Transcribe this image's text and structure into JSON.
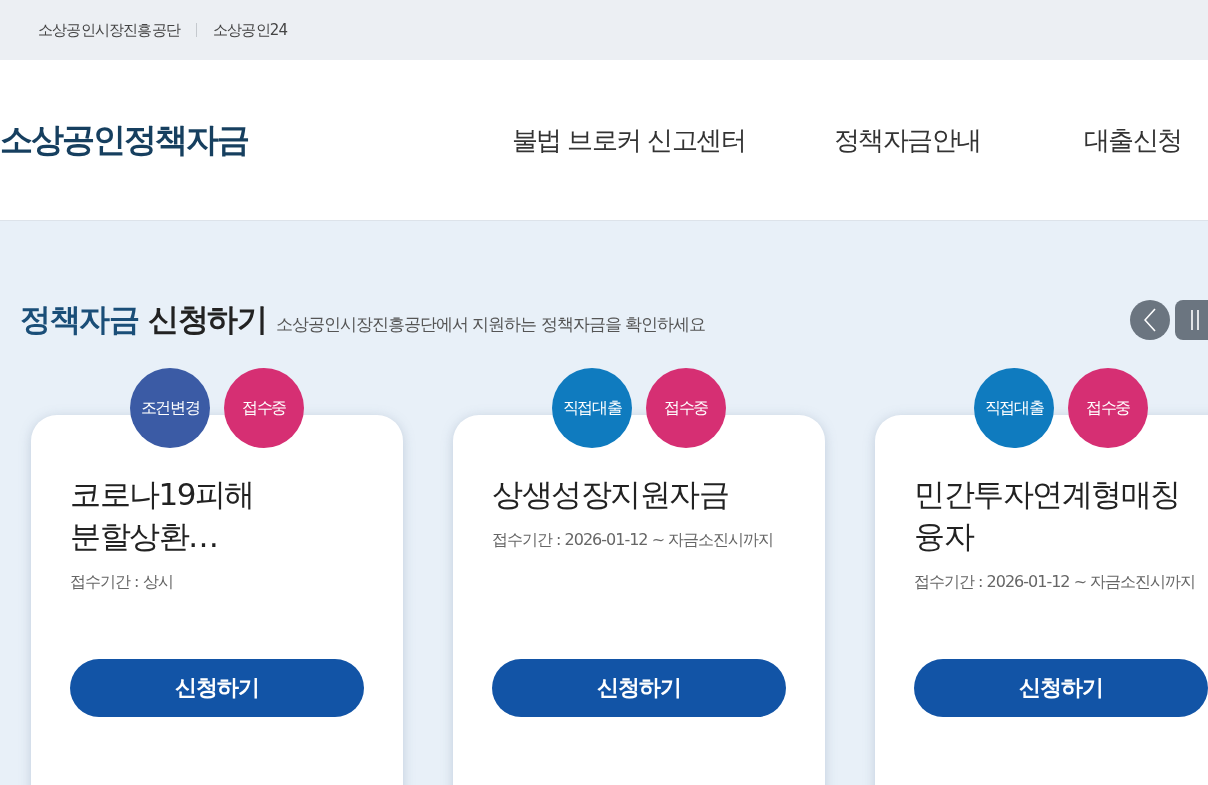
{
  "top_links": [
    "소상공인시장진흥공단",
    "소상공인24"
  ],
  "logo": "소상공인정책자금",
  "nav": [
    "불법 브로커 신고센터",
    "정책자금안내",
    "대출신청"
  ],
  "section": {
    "title_highlight": "정책자금",
    "title_rest": "신청하기",
    "subtitle": "소상공인시장진흥공단에서 지원하는 정책자금을 확인하세요"
  },
  "cards": [
    {
      "badges": [
        {
          "label": "조건변경",
          "color": "#3b5ba5"
        },
        {
          "label": "접수중",
          "color": "#d62f73"
        }
      ],
      "title": "코로나19피해 분할상환…",
      "period": "접수기간 : 상시",
      "button": "신청하기"
    },
    {
      "badges": [
        {
          "label": "직접대출",
          "color": "#0f7bbf"
        },
        {
          "label": "접수중",
          "color": "#d62f73"
        }
      ],
      "title": "상생성장지원자금",
      "period": "접수기간 : 2026-01-12 ~ 자금소진시까지",
      "button": "신청하기"
    },
    {
      "badges": [
        {
          "label": "직접대출",
          "color": "#0f7bbf"
        },
        {
          "label": "접수중",
          "color": "#d62f73"
        }
      ],
      "title": "민간투자연계형매칭융자",
      "period": "접수기간 : 2026-01-12 ~ 자금소진시까지",
      "button": "신청하기"
    }
  ]
}
